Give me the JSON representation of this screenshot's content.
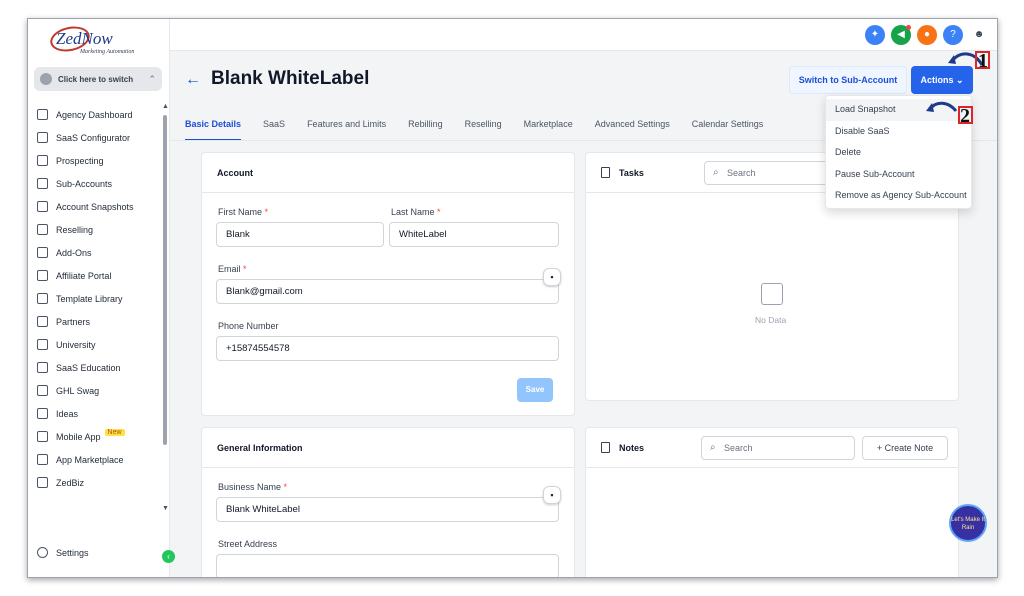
{
  "app": {
    "logo_text": "ZedNow",
    "logo_tagline": "Marketing Automation",
    "switcher_label": "Click here to switch"
  },
  "sidebar": {
    "items": [
      {
        "label": "Agency Dashboard",
        "icon": "dashboard-icon"
      },
      {
        "label": "SaaS Configurator",
        "icon": "chart-icon"
      },
      {
        "label": "Prospecting",
        "icon": "users-icon"
      },
      {
        "label": "Sub-Accounts",
        "icon": "user-icon"
      },
      {
        "label": "Account Snapshots",
        "icon": "snapshot-icon"
      },
      {
        "label": "Reselling",
        "icon": "reselling-icon"
      },
      {
        "label": "Add-Ons",
        "icon": "bag-icon"
      },
      {
        "label": "Affiliate Portal",
        "icon": "group-icon"
      },
      {
        "label": "Template Library",
        "icon": "shapes-icon"
      },
      {
        "label": "Partners",
        "icon": "handshake-icon"
      },
      {
        "label": "University",
        "icon": "graduation-icon"
      },
      {
        "label": "SaaS Education",
        "icon": "education-icon"
      },
      {
        "label": "GHL Swag",
        "icon": "store-icon"
      },
      {
        "label": "Ideas",
        "icon": "bulb-icon"
      },
      {
        "label": "Mobile App",
        "icon": "phone-icon",
        "badge": "New"
      },
      {
        "label": "App Marketplace",
        "icon": "grid-icon"
      },
      {
        "label": "ZedBiz",
        "icon": "globe-icon"
      }
    ],
    "settings_label": "Settings"
  },
  "header": {
    "title": "Blank WhiteLabel",
    "switch_button": "Switch to Sub-Account",
    "actions_button": "Actions"
  },
  "tabs": [
    "Basic Details",
    "SaaS",
    "Features and Limits",
    "Rebilling",
    "Reselling",
    "Marketplace",
    "Advanced Settings",
    "Calendar Settings"
  ],
  "account": {
    "heading": "Account",
    "first_name_label": "First Name",
    "first_name": "Blank",
    "last_name_label": "Last Name",
    "last_name": "WhiteLabel",
    "email_label": "Email",
    "email": "Blank@gmail.com",
    "phone_label": "Phone Number",
    "phone": "+15874554578",
    "required_mark": "*",
    "save_label": "Save"
  },
  "general": {
    "heading": "General Information",
    "business_name_label": "Business Name",
    "business_name": "Blank WhiteLabel",
    "street_label": "Street Address"
  },
  "tasks": {
    "heading": "Tasks",
    "search_placeholder": "Search",
    "empty_text": "No Data"
  },
  "notes": {
    "heading": "Notes",
    "search_placeholder": "Search",
    "create_label": "Create Note"
  },
  "actions_menu": [
    "Load Snapshot",
    "Disable SaaS",
    "Delete",
    "Pause Sub-Account",
    "Remove as Agency Sub-Account"
  ],
  "annotations": {
    "step1": "1",
    "step2": "2"
  },
  "fab_text": "Let's Make It Rain",
  "colors": {
    "accent": "#2563eb",
    "sidebar_bg": "#ffffff",
    "save_disabled": "#93c5fd"
  }
}
